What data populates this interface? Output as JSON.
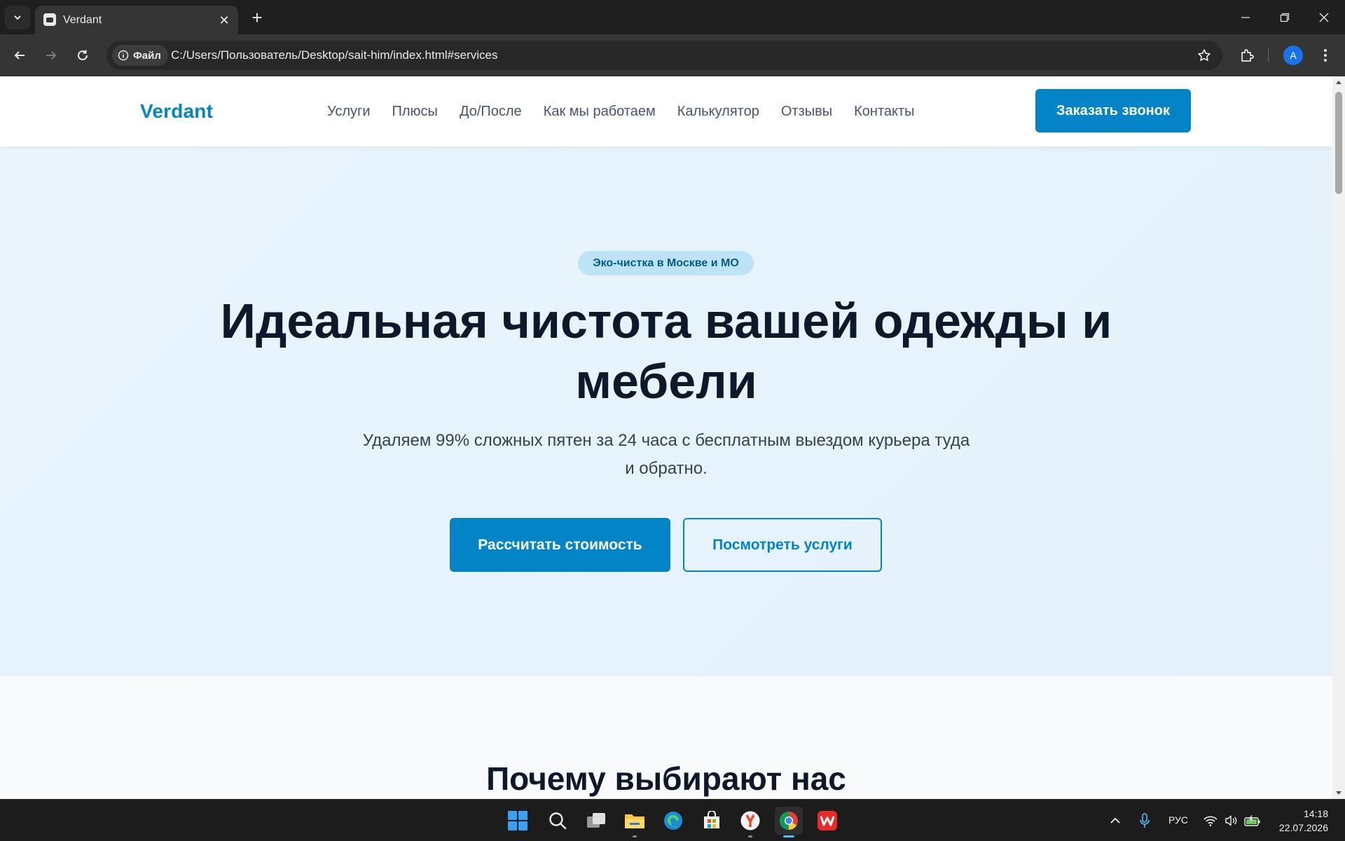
{
  "browser": {
    "tab_title": "Verdant",
    "address_chip": "Файл",
    "url": "C:/Users/Пользователь/Desktop/sait-him/index.html#services",
    "profile_initial": "A"
  },
  "site": {
    "logo": "Verdant",
    "nav": [
      "Услуги",
      "Плюсы",
      "До/После",
      "Как мы работаем",
      "Калькулятор",
      "Отзывы",
      "Контакты"
    ],
    "header_cta": "Заказать звонок",
    "hero": {
      "badge": "Эко-чистка в Москве и МО",
      "title": "Идеальная чистота вашей одежды и мебели",
      "subtitle": "Удаляем 99% сложных пятен за 24 часа с бесплатным выездом курьера туда и обратно.",
      "primary_button": "Рассчитать стоимость",
      "secondary_button": "Посмотреть услуги"
    },
    "why_title": "Почему выбирают нас"
  },
  "taskbar": {
    "language": "РУС",
    "time": "14:18",
    "date": "22.07.2026"
  },
  "colors": {
    "brand": "#0284c7",
    "hero_bg": "#e6f3fc",
    "heading": "#0f172a"
  }
}
